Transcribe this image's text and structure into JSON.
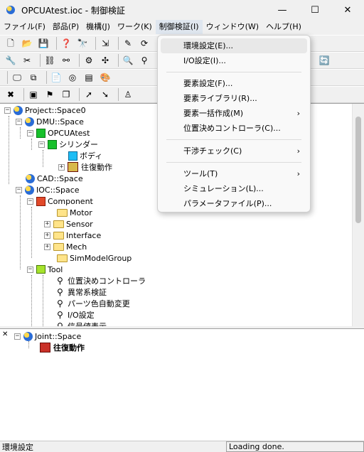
{
  "window": {
    "title": "OPCUAtest.ioc - 制御検証",
    "minimize": "—",
    "maximize": "☐",
    "close": "✕"
  },
  "menubar": [
    {
      "label": "ファイル(F)"
    },
    {
      "label": "部品(P)"
    },
    {
      "label": "機構(J)"
    },
    {
      "label": "ワーク(K)"
    },
    {
      "label": "制御検証(I)"
    },
    {
      "label": "ウィンドウ(W)"
    },
    {
      "label": "ヘルプ(H)"
    }
  ],
  "dropdown": {
    "items": [
      {
        "label": "環境設定(E)...",
        "submenu": false,
        "highlighted": true
      },
      {
        "label": "I/O設定(I)...",
        "submenu": false
      },
      {
        "separator": true
      },
      {
        "label": "要素設定(F)...",
        "submenu": false
      },
      {
        "label": "要素ライブラリ(R)...",
        "submenu": false
      },
      {
        "label": "要素一括作成(M)",
        "submenu": true
      },
      {
        "label": "位置決めコントローラ(C)...",
        "submenu": false
      },
      {
        "separator": true
      },
      {
        "label": "干渉チェック(C)",
        "submenu": true
      },
      {
        "separator": true
      },
      {
        "label": "ツール(T)",
        "submenu": true
      },
      {
        "label": "シミュレーション(L)...",
        "submenu": false
      },
      {
        "label": "パラメータファイル(P)...",
        "submenu": false
      }
    ],
    "submenu_arrow": "›"
  },
  "tree": {
    "nodes": [
      {
        "label": "Project::Space0",
        "icon": "globe-icon",
        "expander": "−"
      },
      {
        "label": "DMU::Space",
        "icon": "globe-icon",
        "expander": "−"
      },
      {
        "label": "OPCUAtest",
        "icon": "green-block-icon",
        "expander": "−"
      },
      {
        "label": "シリンダー",
        "icon": "green-block-icon",
        "expander": "−"
      },
      {
        "label": "ボディ",
        "icon": "cyan-block-icon",
        "expander": ""
      },
      {
        "label": "往復動作",
        "icon": "action-icon",
        "expander": "+"
      },
      {
        "label": "CAD::Space",
        "icon": "globe-icon",
        "expander": ""
      },
      {
        "label": "IOC::Space",
        "icon": "globe-icon",
        "expander": "−"
      },
      {
        "label": "Component",
        "icon": "component-icon",
        "expander": "−"
      },
      {
        "label": "Motor",
        "icon": "folder-icon",
        "expander": ""
      },
      {
        "label": "Sensor",
        "icon": "folder-icon",
        "expander": "+"
      },
      {
        "label": "Interface",
        "icon": "folder-icon",
        "expander": "+"
      },
      {
        "label": "Mech",
        "icon": "folder-icon",
        "expander": "+"
      },
      {
        "label": "SimModelGroup",
        "icon": "folder-icon",
        "expander": ""
      },
      {
        "label": "Tool",
        "icon": "tool-icon",
        "expander": "−"
      },
      {
        "label": "位置決めコントローラ",
        "icon": "probe-icon",
        "expander": ""
      },
      {
        "label": "異常系検証",
        "icon": "probe-icon",
        "expander": ""
      },
      {
        "label": "パーツ色自動変更",
        "icon": "probe-icon",
        "expander": ""
      },
      {
        "label": "I/O設定",
        "icon": "probe-icon",
        "expander": ""
      },
      {
        "label": "信号値表示",
        "icon": "probe-icon",
        "expander": ""
      }
    ]
  },
  "lower_tree": {
    "close_glyph": "✕",
    "nodes": [
      {
        "label": "Joint::Space",
        "icon": "globe-icon",
        "expander": "−"
      },
      {
        "label": "往復動作",
        "icon": "action-icon",
        "expander": ""
      }
    ]
  },
  "status": {
    "left": "環境設定",
    "right": "Loading done."
  }
}
